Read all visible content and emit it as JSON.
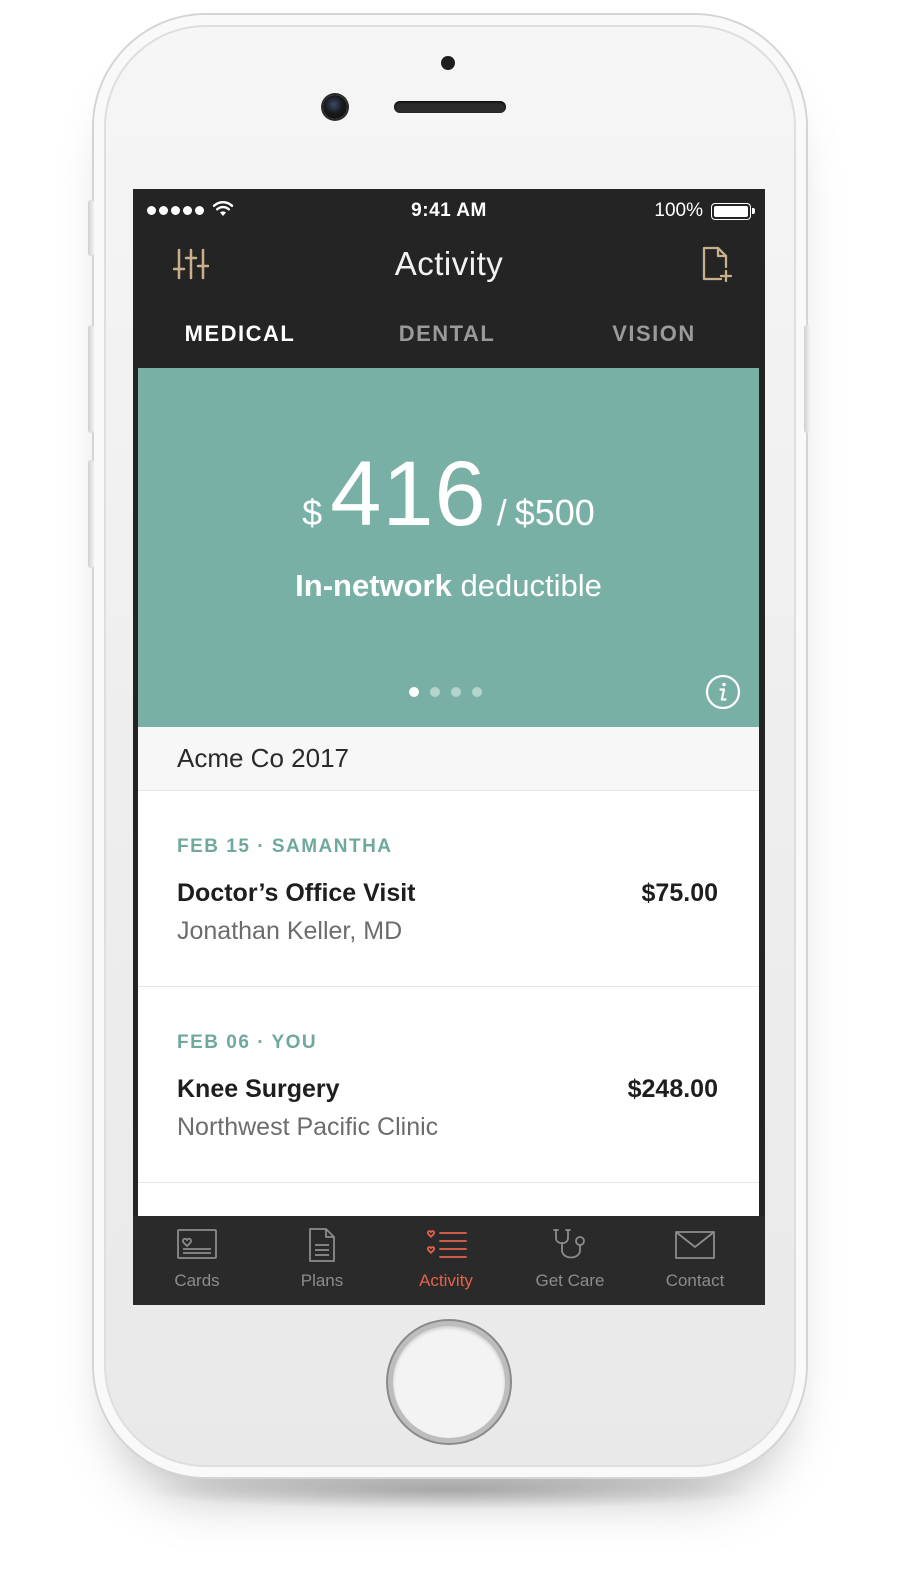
{
  "status_bar": {
    "time": "9:41 AM",
    "battery": "100%",
    "icons": [
      "signal-dots-icon",
      "wifi-icon",
      "battery-icon"
    ]
  },
  "nav": {
    "title": "Activity",
    "left_icon": "filter-sliders-icon",
    "right_icon": "new-document-icon"
  },
  "tabs": [
    {
      "label": "MEDICAL",
      "active": true
    },
    {
      "label": "DENTAL",
      "active": false
    },
    {
      "label": "VISION",
      "active": false
    }
  ],
  "summary": {
    "currency": "$",
    "amount": "416",
    "separator": "/",
    "total": "$500",
    "label_strong": "In-network",
    "label_rest": "deductible",
    "page_count": 4,
    "active_page": 1,
    "info_icon": "info-icon",
    "background_color": "#79b0a5"
  },
  "plan": {
    "name": "Acme Co 2017"
  },
  "activity_items": [
    {
      "date": "FEB 15",
      "member": "SAMANTHA",
      "title": "Doctor’s Office Visit",
      "provider": "Jonathan Keller, MD",
      "amount": "$75.00"
    },
    {
      "date": "FEB 06",
      "member": "YOU",
      "title": "Knee Surgery",
      "provider": "Northwest Pacific Clinic",
      "amount": "$248.00"
    }
  ],
  "tabbar": {
    "items": [
      {
        "label": "Cards",
        "icon": "card-icon",
        "active": false
      },
      {
        "label": "Plans",
        "icon": "document-icon",
        "active": false
      },
      {
        "label": "Activity",
        "icon": "activity-list-icon",
        "active": true
      },
      {
        "label": "Get Care",
        "icon": "stethoscope-icon",
        "active": false
      },
      {
        "label": "Contact",
        "icon": "envelope-icon",
        "active": false
      }
    ],
    "active_color": "#e5614c",
    "inactive_color": "#8c8c8c"
  },
  "colors": {
    "nav_background": "#242424",
    "accent_teal": "#79b0a5",
    "meta_teal": "#6fa89c",
    "accent_red": "#e5614c",
    "icon_gold": "#c8b08a"
  }
}
